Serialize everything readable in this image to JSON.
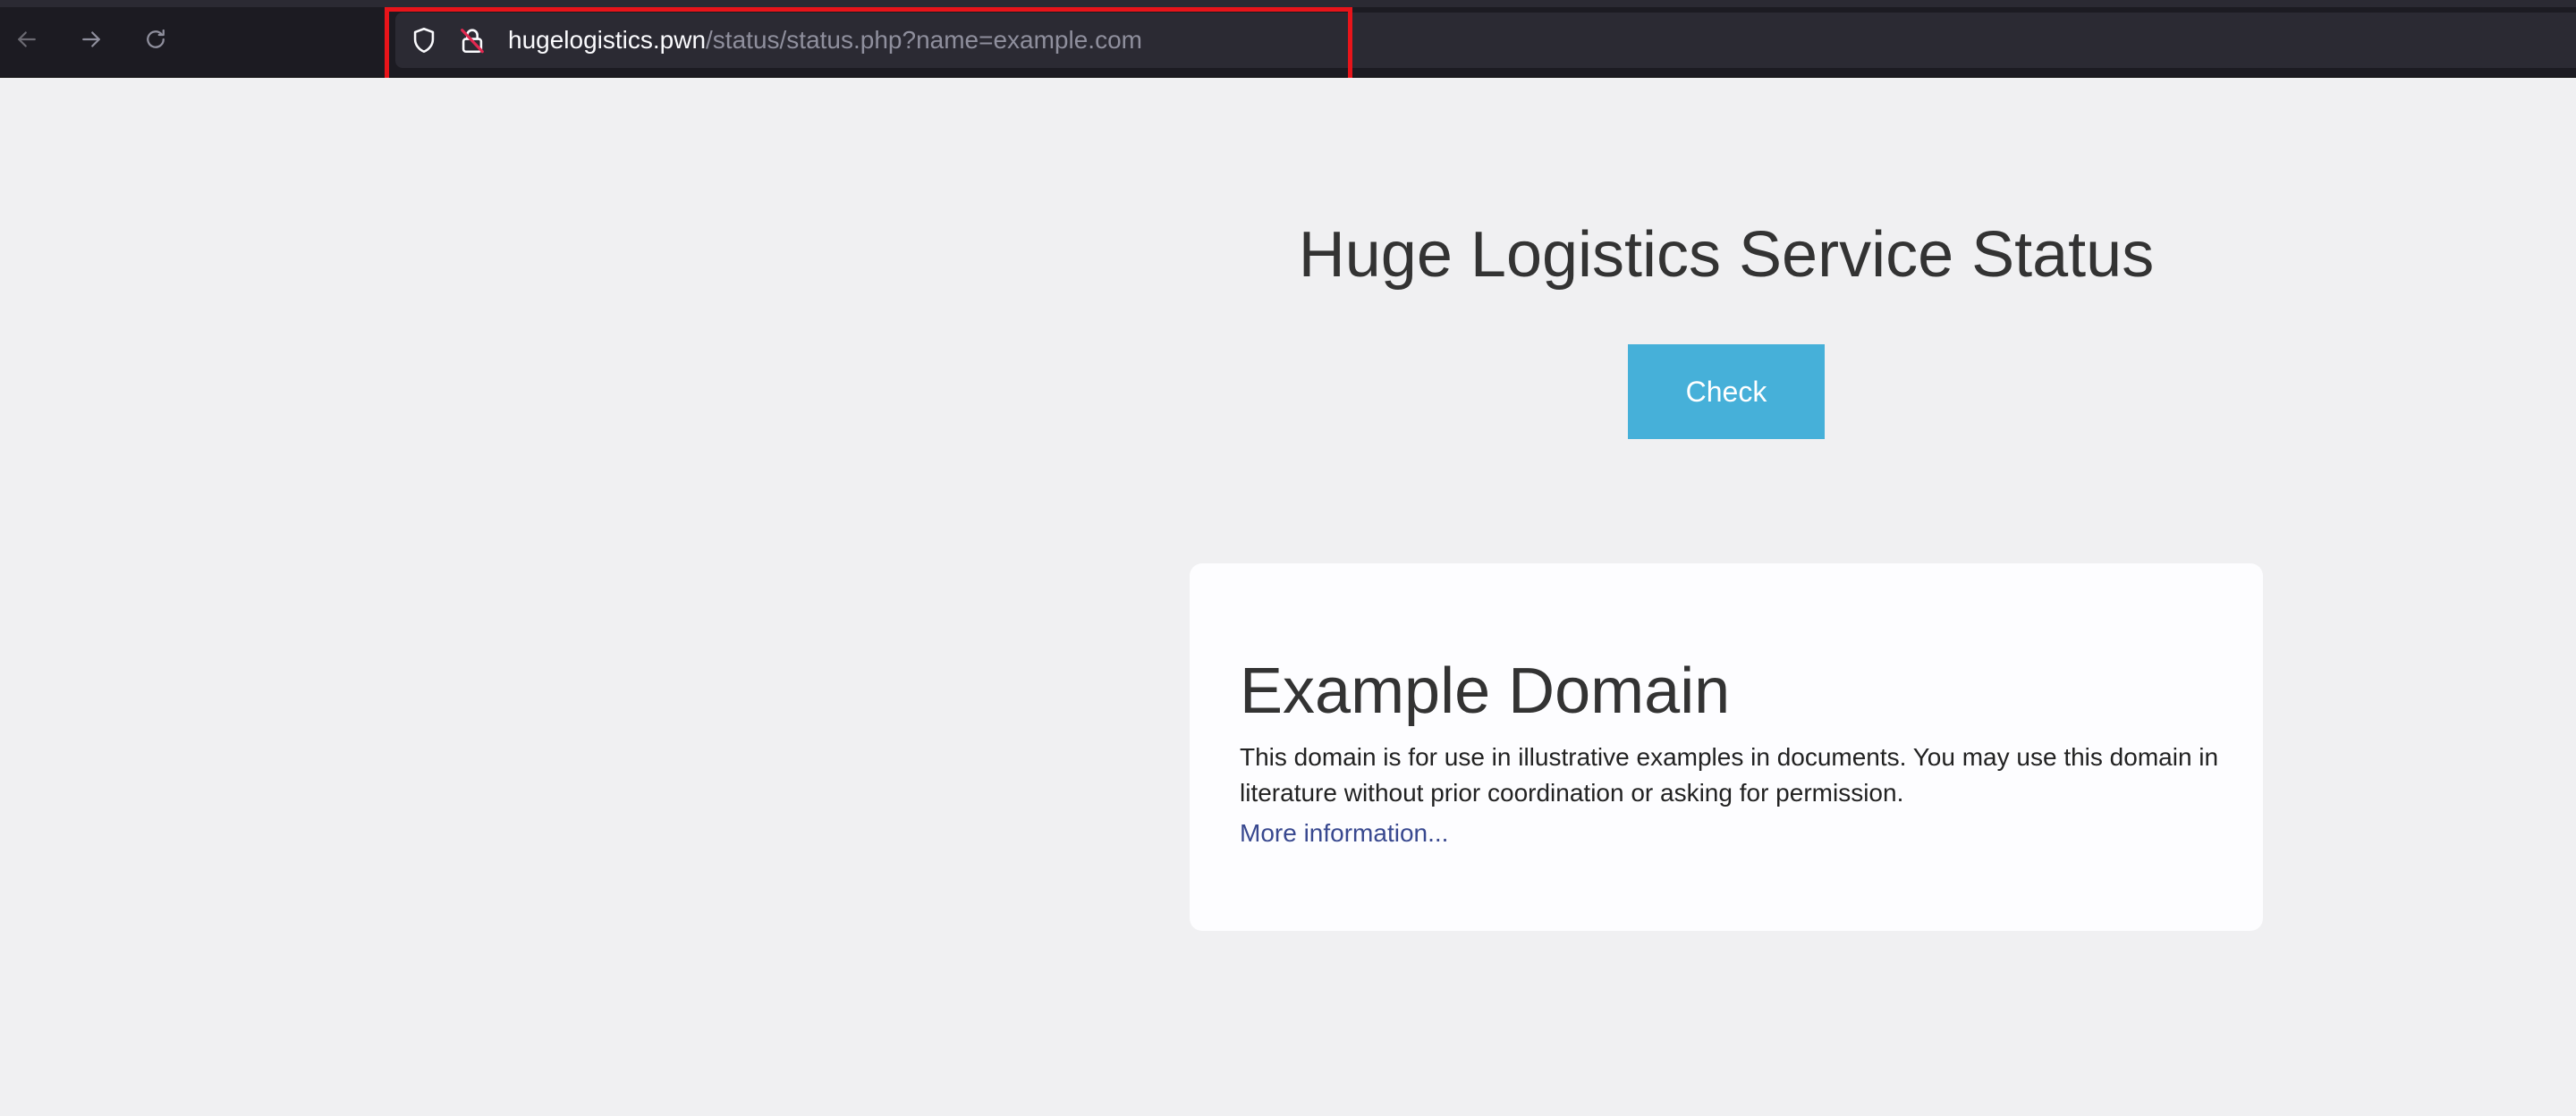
{
  "browser": {
    "url_host": "hugelogistics.pwn",
    "url_path": "/status/status.php?name=example.com",
    "icons": [
      "back-arrow-icon",
      "forward-arrow-icon",
      "reload-icon",
      "tracking-shield-icon",
      "insecure-lock-icon"
    ],
    "highlight_color": "#e8141a"
  },
  "page": {
    "title": "Huge Logistics Service Status",
    "check_label": "Check",
    "check_color": "#46b0d9"
  },
  "card": {
    "title": "Example Domain",
    "text": "This domain is for use in illustrative examples in documents. You may use this domain in literature without prior coordination or asking for permission.",
    "link": "More information..."
  }
}
